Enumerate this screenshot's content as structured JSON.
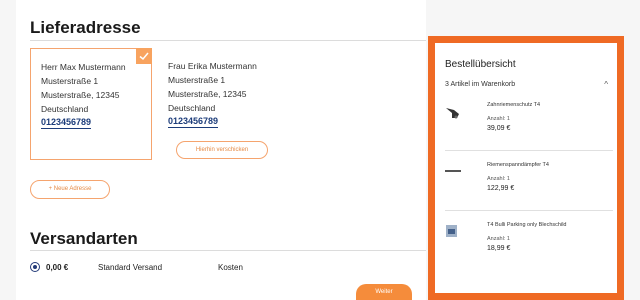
{
  "delivery": {
    "title": "Lieferadresse",
    "addresses": [
      {
        "name": "Herr Max Mustermann",
        "street": "Musterstraße 1",
        "city": "Musterstraße, 12345",
        "country": "Deutschland",
        "phone": "0123456789",
        "selected": true
      },
      {
        "name": "Frau Erika Mustermann",
        "street": "Musterstraße 1",
        "city": "Musterstraße, 12345",
        "country": "Deutschland",
        "phone": "0123456789",
        "selected": false
      }
    ],
    "ship_here_label": "Hierhin verschicken",
    "new_address_label": "+ Neue Adresse"
  },
  "shipping": {
    "title": "Versandarten",
    "options": [
      {
        "price": "0,00 €",
        "name": "Standard Versand",
        "cost_label": "Kosten",
        "selected": true
      }
    ]
  },
  "next_button": "Weiter",
  "summary": {
    "title": "Bestellübersicht",
    "count": "3 Artikel im Warenkorb",
    "items": [
      {
        "name": "Zahnriemenschutz T4",
        "qty": "Anzahl: 1",
        "price": "39,09 €",
        "icon": "pump-icon"
      },
      {
        "name": "Riemenspanndämpfer T4",
        "qty": "Anzahl: 1",
        "price": "122,99 €",
        "icon": "damper-icon"
      },
      {
        "name": "T4 Bulli Parking only Blechschild",
        "qty": "Anzahl: 1",
        "price": "18,99 €",
        "icon": "sign-icon"
      }
    ]
  },
  "colors": {
    "accent": "#ef6a24",
    "link": "#1c3c7a",
    "border_selected": "#f5a46e"
  }
}
